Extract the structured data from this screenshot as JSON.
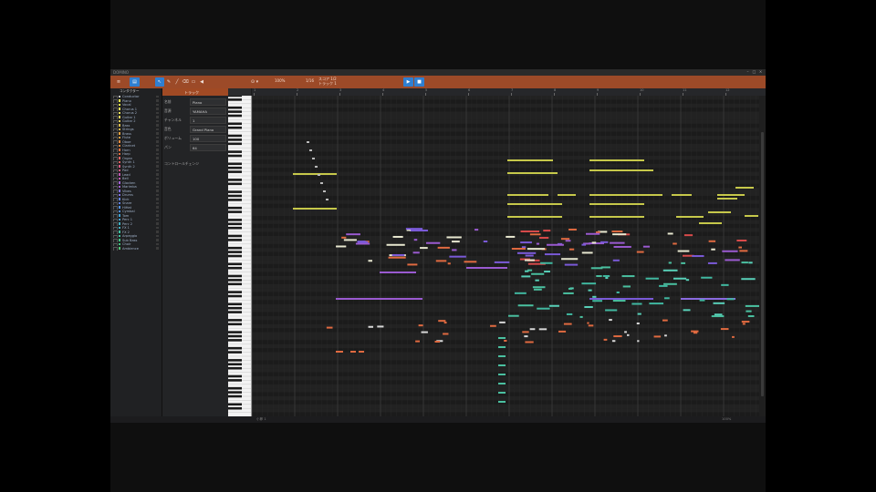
{
  "window": {
    "title": "DOMINO"
  },
  "toolbar": {
    "project_line1": "スコア 1/2",
    "project_line2": "トラック 1",
    "zoom_value": "100%",
    "snap_value": "1/16"
  },
  "tracklist": {
    "header": "コンダクター",
    "tracks": [
      {
        "name": "Conductor",
        "color": "#c8c8c8"
      },
      {
        "name": "Piano",
        "color": "#f2f24a"
      },
      {
        "name": "Vocal",
        "color": "#f2f24a"
      },
      {
        "name": "Chorus 1",
        "color": "#e8e35a"
      },
      {
        "name": "Chorus 2",
        "color": "#e8e35a"
      },
      {
        "name": "Guitar 1",
        "color": "#e8d25a"
      },
      {
        "name": "Guitar 2",
        "color": "#e8d25a"
      },
      {
        "name": "Bass",
        "color": "#d8b84a"
      },
      {
        "name": "Strings",
        "color": "#d8b84a"
      },
      {
        "name": "Brass",
        "color": "#e0a040"
      },
      {
        "name": "Flute",
        "color": "#e0a040"
      },
      {
        "name": "Oboe",
        "color": "#e08a40"
      },
      {
        "name": "Clarinet",
        "color": "#e08a40"
      },
      {
        "name": "Horn",
        "color": "#e07040"
      },
      {
        "name": "Harp",
        "color": "#e07040"
      },
      {
        "name": "Organ",
        "color": "#e06060"
      },
      {
        "name": "Synth 1",
        "color": "#e06060"
      },
      {
        "name": "Synth 2",
        "color": "#d85a80"
      },
      {
        "name": "Pad",
        "color": "#d85a80"
      },
      {
        "name": "Lead",
        "color": "#c058b0"
      },
      {
        "name": "Bell",
        "color": "#c058b0"
      },
      {
        "name": "Glocken",
        "color": "#a060d0"
      },
      {
        "name": "Marimba",
        "color": "#a060d0"
      },
      {
        "name": "Vibes",
        "color": "#8070e0"
      },
      {
        "name": "Drums",
        "color": "#8070e0"
      },
      {
        "name": "Kick",
        "color": "#6080e0"
      },
      {
        "name": "Snare",
        "color": "#6080e0"
      },
      {
        "name": "HiHat",
        "color": "#5090e0"
      },
      {
        "name": "Cymbal",
        "color": "#5090e0"
      },
      {
        "name": "Tom",
        "color": "#40a0d0"
      },
      {
        "name": "Perc 1",
        "color": "#40a0d0"
      },
      {
        "name": "Perc 2",
        "color": "#40b0c0"
      },
      {
        "name": "FX 1",
        "color": "#40b0c0"
      },
      {
        "name": "FX 2",
        "color": "#40c0a0"
      },
      {
        "name": "Arpeggio",
        "color": "#40c0a0"
      },
      {
        "name": "Sub Bass",
        "color": "#40c080"
      },
      {
        "name": "Choir",
        "color": "#40c080"
      },
      {
        "name": "Ambience",
        "color": "#50c070"
      }
    ]
  },
  "props": {
    "header": "トラック",
    "rows": [
      {
        "label": "名前",
        "value": "Piano"
      },
      {
        "label": "音源",
        "value": "YAMAHA"
      },
      {
        "label": "チャンネル",
        "value": "1"
      },
      {
        "label": "音色",
        "value": "Grand Piano"
      },
      {
        "label": "ボリューム",
        "value": "100"
      },
      {
        "label": "パン",
        "value": "64"
      }
    ],
    "footer": "コントロールチェンジ"
  },
  "ruler": {
    "bars": [
      "1",
      "2",
      "3",
      "4",
      "5",
      "6",
      "7",
      "8",
      "9",
      "10",
      "11",
      "12"
    ]
  },
  "status": {
    "left": "小節 1",
    "right": "100%"
  },
  "colors": {
    "accent": "#9c4a28",
    "button_blue": "#2f7fd1",
    "roll_bg": "#202020"
  },
  "icons": [
    "menu-icon",
    "pointer-icon",
    "pencil-icon",
    "eraser-icon",
    "select-icon",
    "speaker-icon",
    "play-icon",
    "stop-icon"
  ]
}
